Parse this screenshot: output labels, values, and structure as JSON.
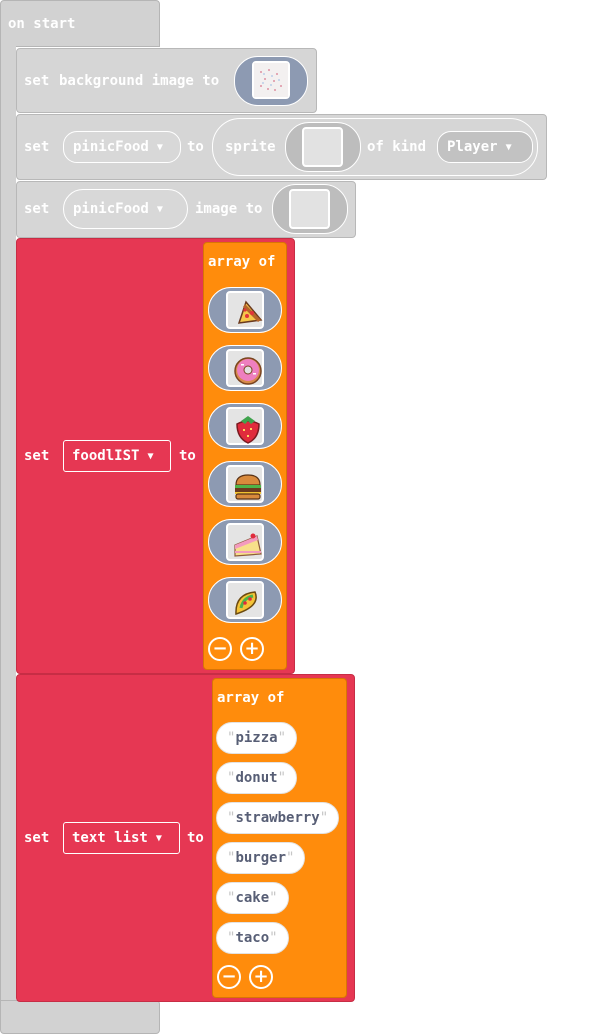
{
  "hat": {
    "label": "on start"
  },
  "row1": {
    "set": "set",
    "text": "background image to"
  },
  "row2": {
    "set": "set",
    "variable": "pinicFood",
    "to": "to",
    "sprite": "sprite",
    "of_kind": "of kind",
    "kind": "Player"
  },
  "row3": {
    "set": "set",
    "variable": "pinicFood",
    "image_to": "image to"
  },
  "row4": {
    "set": "set",
    "variable": "foodlIST",
    "to": "to",
    "array_of": "array of",
    "items": [
      "pizza-image",
      "donut-image",
      "strawberry-image",
      "burger-image",
      "cake-image",
      "taco-image"
    ]
  },
  "row5": {
    "set": "set",
    "variable": "text list",
    "to": "to",
    "array_of": "array of",
    "items": [
      "pizza",
      "donut",
      "strawberry",
      "burger",
      "cake",
      "taco"
    ]
  },
  "colors": {
    "gray": "#d2d2d2",
    "red": "#e63753",
    "orange": "#ff8c0c",
    "slot": "#8d9ab2"
  }
}
